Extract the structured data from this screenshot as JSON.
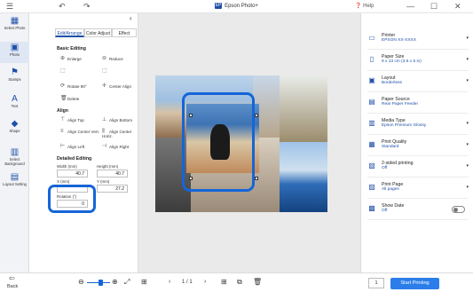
{
  "titlebar": {
    "logo": "EP",
    "title": "Epson Photo+",
    "help": "Help",
    "icons": [
      "menu-icon",
      "undo-icon",
      "redo-icon"
    ],
    "window": [
      "—",
      "☐",
      "✕"
    ]
  },
  "left_strip": {
    "items": [
      {
        "label": "Select Photo",
        "icon": "▦"
      },
      {
        "label": "Photo",
        "icon": "▣"
      },
      {
        "label": "Stamps",
        "icon": "⚑"
      },
      {
        "label": "Text",
        "icon": "A"
      },
      {
        "label": "Shape",
        "icon": "◆"
      },
      {
        "label": "Select Background",
        "icon": "▥"
      },
      {
        "label": "Layout Setting",
        "icon": "▤"
      }
    ]
  },
  "panel": {
    "tabs": [
      "Edit/Arrange",
      "Color Adjust",
      "Effect"
    ],
    "basic_editing": "Basic Editing",
    "enlarge": "Enlarge",
    "reduce": "Reduce",
    "rotate": "Rotate 90°",
    "center_align": "Center Align",
    "delete": "Delete",
    "align": "Align",
    "align_top": "Align Top",
    "align_bottom": "Align Bottom",
    "align_center_vert": "Align Center Vert.",
    "align_center_horiz": "Align Center Horiz.",
    "align_left": "Align Left",
    "align_right": "Align Right",
    "detailed_editing": "Detailed Editing",
    "width_label": "Width (mm)",
    "width_value": "40.7",
    "height_label": "Height (mm)",
    "height_value": "40.7",
    "x_label": "X (mm)",
    "x_value": "",
    "y_label": "Y (mm)",
    "y_value": "27.2",
    "rotation_label": "Rotation (°)",
    "rotation_value": "0"
  },
  "right_panel": {
    "rows": [
      {
        "label": "Printer",
        "value": "EPSON XX-XXXX",
        "icon": "▭"
      },
      {
        "label": "Paper Size",
        "value": "9 x 13 cm (3.5 x 5 in)",
        "icon": "▯"
      },
      {
        "label": "Layout",
        "value": "Borderless",
        "icon": "▣"
      },
      {
        "label": "Paper Source",
        "value": "Rear Paper Feeder",
        "icon": "▤"
      },
      {
        "label": "Media Type",
        "value": "Epson Premium Glossy",
        "icon": "▥"
      },
      {
        "label": "Print Quality",
        "value": "Standard",
        "icon": "▦"
      },
      {
        "label": "2-sided printing",
        "value": "Off",
        "icon": "▧"
      },
      {
        "label": "Print Page",
        "value": "All pages",
        "icon": "▨"
      },
      {
        "label": "Show Date",
        "value": "Off",
        "icon": "▩"
      }
    ]
  },
  "bottom": {
    "back": "Back",
    "page": "1 / 1",
    "copies": "1",
    "start": "Start Printing"
  },
  "colors": {
    "accent": "#1565d8",
    "start": "#2b7de9"
  }
}
